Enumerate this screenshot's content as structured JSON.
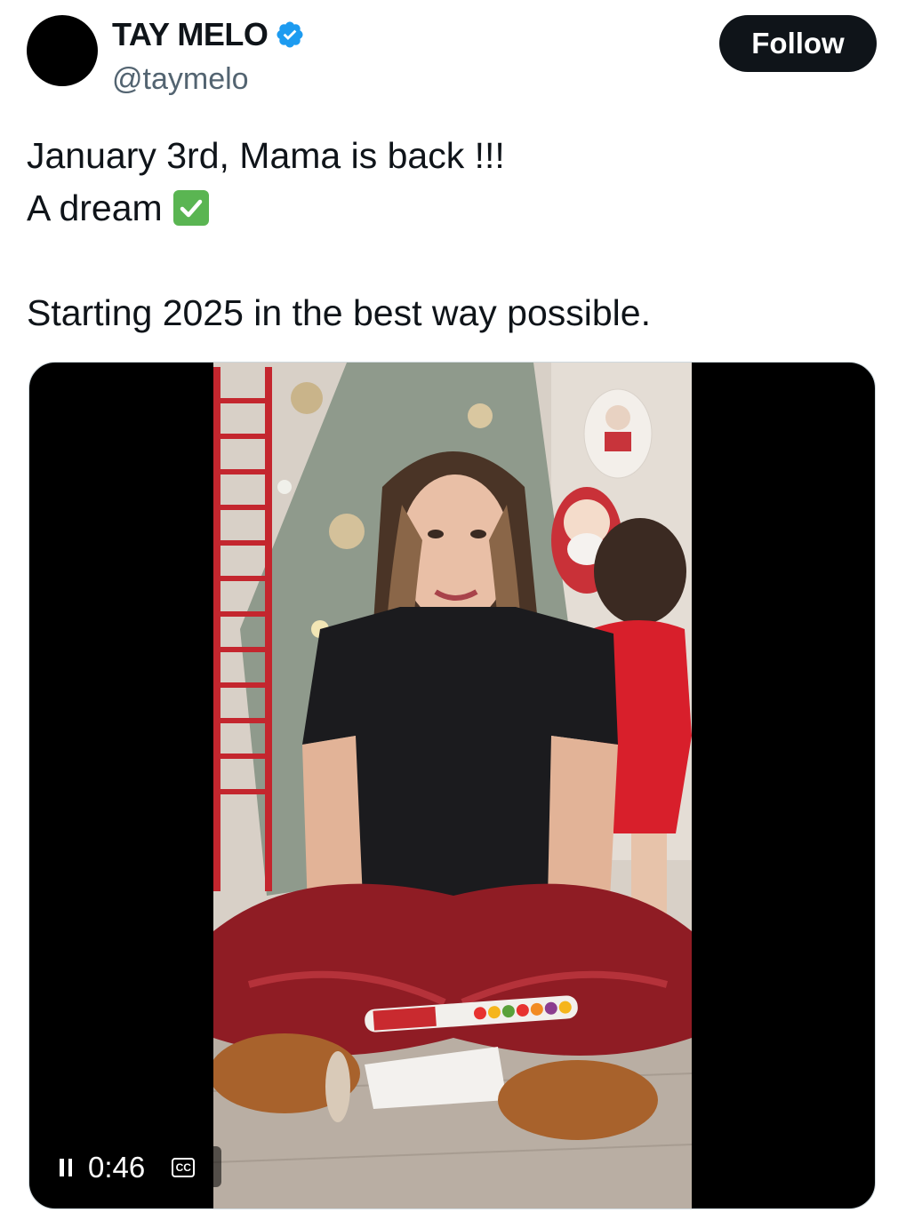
{
  "author": {
    "name": "TAY MELO",
    "handle": "@taymelo",
    "verified": true,
    "badge_color": "#1d9bf0"
  },
  "follow_label": "Follow",
  "tweet": {
    "line1": "January 3rd, Mama is back !!!",
    "line2": "A dream",
    "line2_emoji": "check-mark-button",
    "line3": "Starting 2025 in the best way possible."
  },
  "video": {
    "state": "playing",
    "time": "0:46",
    "captions_label": "CC",
    "icons": [
      "pause-icon",
      "captions-icon"
    ]
  }
}
